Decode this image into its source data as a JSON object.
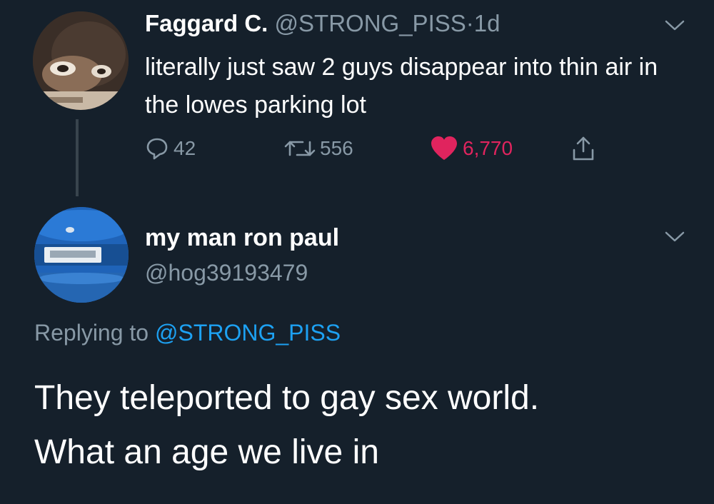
{
  "tweet1": {
    "display_name": "Faggard C.",
    "handle": "@STRONG_PISS",
    "separator": "·",
    "age": "1d",
    "text": "literally just saw 2 guys disappear into thin air in the lowes parking lot",
    "actions": {
      "reply_count": "42",
      "retweet_count": "556",
      "like_count": "6,770"
    },
    "avatar_icon": "monkey-face-avatar",
    "colors": {
      "like": "#e0245e",
      "muted": "#8899a6",
      "background": "#15202b"
    }
  },
  "tweet2": {
    "display_name": "my man ron paul",
    "handle": "@hog39193479",
    "avatar_icon": "blue-car-license-plate-avatar",
    "replying_to_label": "Replying to",
    "replying_to_handle": "@STRONG_PISS",
    "text_line1": "They teleported to gay sex world.",
    "text_line2": "What an age we live in",
    "colors": {
      "mention": "#1da1f2"
    }
  }
}
